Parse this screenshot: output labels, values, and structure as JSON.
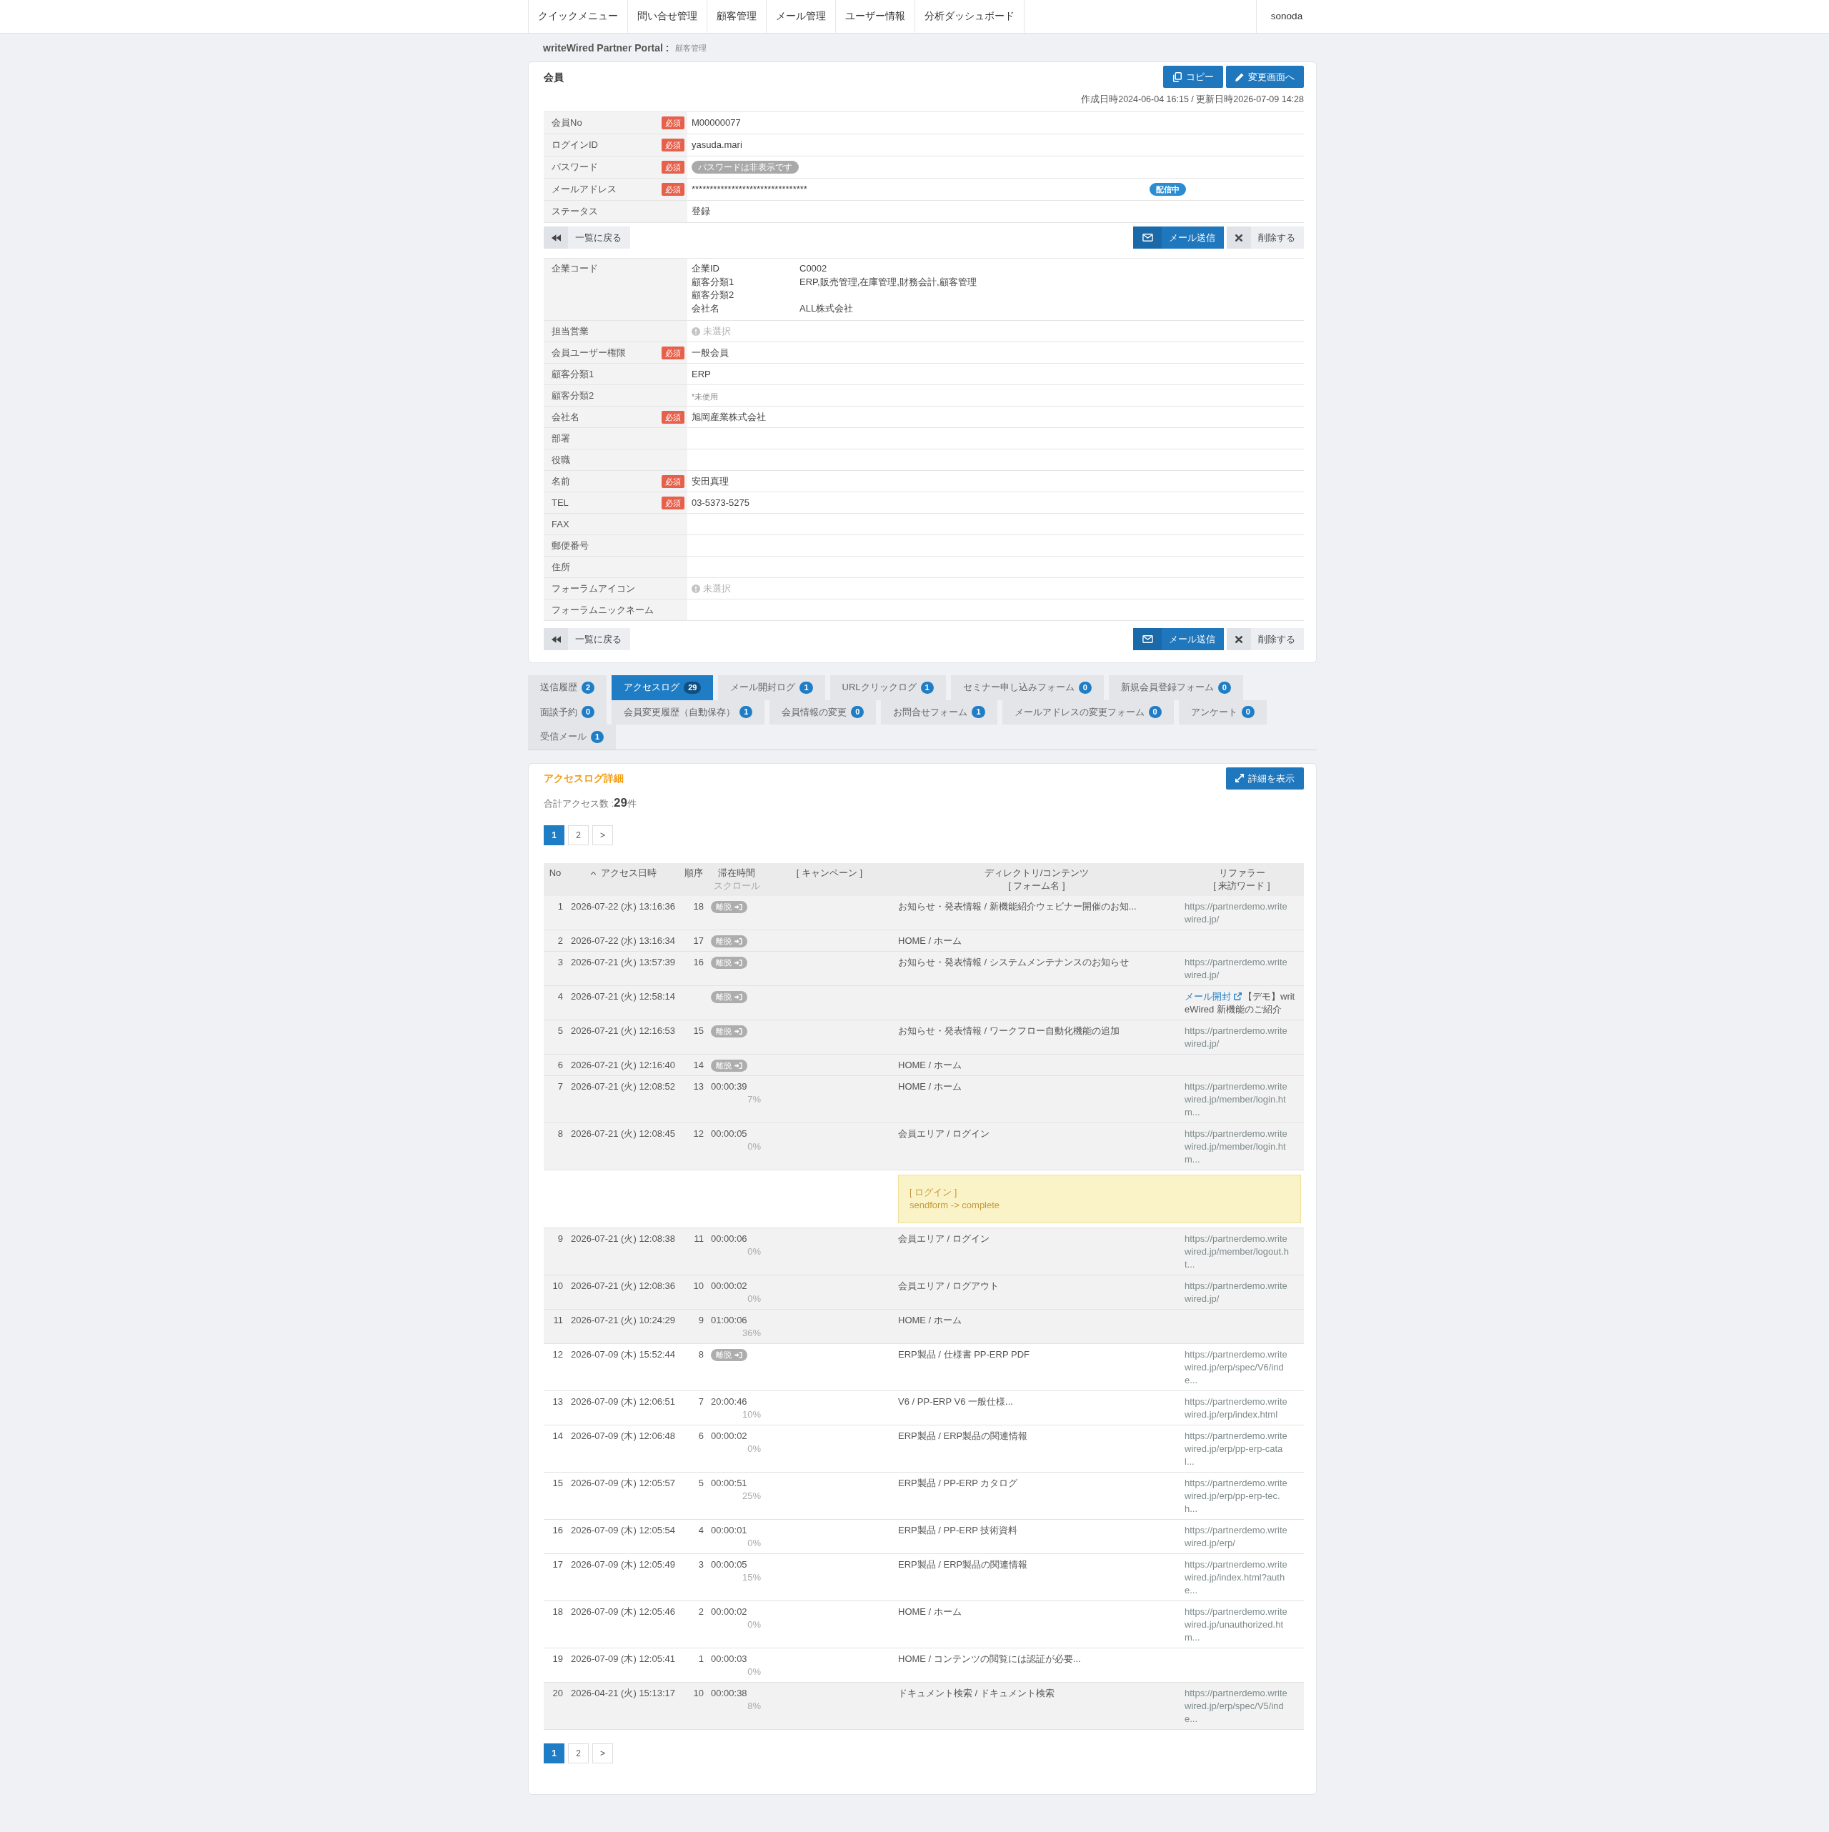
{
  "nav": {
    "items": [
      {
        "label": "クイックメニュー"
      },
      {
        "label": "問い合せ管理"
      },
      {
        "label": "顧客管理"
      },
      {
        "label": "メール管理"
      },
      {
        "label": "ユーザー情報"
      },
      {
        "label": "分析ダッシュボード"
      }
    ],
    "user": "sonoda"
  },
  "breadcrumb": {
    "portal": "writeWired Partner Portal :",
    "section": "顧客管理"
  },
  "member": {
    "title": "会員",
    "buttons": [
      {
        "kind": "copy",
        "label": "コピー"
      },
      {
        "kind": "edit",
        "label": "変更画面へ"
      }
    ],
    "timestamps": "作成日時2024-06-04 16:15 / 更新日時2026-07-09 14:28",
    "account_fields": [
      {
        "label": "会員No",
        "badge": "必須",
        "kind": "text",
        "value": "M00000077"
      },
      {
        "label": "ログインID",
        "badge": "必須",
        "kind": "text",
        "value": "yasuda.mari"
      },
      {
        "label": "パスワード",
        "badge": "必須",
        "kind": "pill",
        "value": "パスワードは非表示です"
      },
      {
        "label": "メールアドレス",
        "badge": "必須",
        "kind": "masked",
        "value": "********************************",
        "status": "配信中"
      },
      {
        "label": "ステータス",
        "kind": "text",
        "value": "登録"
      }
    ],
    "actions_top": [
      {
        "kind": "back",
        "label": "一覧に戻る"
      },
      {
        "kind": "mail",
        "label": "メール送信"
      },
      {
        "kind": "delete",
        "label": "削除する"
      }
    ],
    "profile_fields": [
      {
        "label": "企業コード",
        "kind": "company",
        "entries": [
          {
            "key": "企業ID",
            "value": "C0002"
          },
          {
            "key": "顧客分類1",
            "value": "ERP,販売管理,在庫管理,財務会計,顧客管理"
          },
          {
            "key": "顧客分類2"
          },
          {
            "key": "会社名",
            "value": "ALL株式会社"
          }
        ]
      },
      {
        "label": "担当営業",
        "kind": "unselected",
        "value": "未選択"
      },
      {
        "label": "会員ユーザー権限",
        "badge": "必須",
        "kind": "text",
        "value": "一般会員"
      },
      {
        "label": "顧客分類1",
        "kind": "text",
        "value": "ERP"
      },
      {
        "label": "顧客分類2",
        "kind": "note",
        "value": "*未使用"
      },
      {
        "label": "会社名",
        "badge": "必須",
        "kind": "text",
        "value": "旭岡産業株式会社"
      },
      {
        "label": "部署",
        "kind": "text"
      },
      {
        "label": "役職",
        "kind": "text"
      },
      {
        "label": "名前",
        "badge": "必須",
        "kind": "text",
        "value": "安田真理"
      },
      {
        "label": "TEL",
        "badge": "必須",
        "kind": "text",
        "value": "03-5373-5275"
      },
      {
        "label": "FAX",
        "kind": "text"
      },
      {
        "label": "郵便番号",
        "kind": "text"
      },
      {
        "label": "住所",
        "kind": "text"
      },
      {
        "label": "フォーラムアイコン",
        "kind": "unselected",
        "value": "未選択"
      },
      {
        "label": "フォーラムニックネーム",
        "kind": "text"
      }
    ],
    "actions_bottom": [
      {
        "kind": "back",
        "label": "一覧に戻る"
      },
      {
        "kind": "mail",
        "label": "メール送信"
      },
      {
        "kind": "delete",
        "label": "削除する"
      }
    ]
  },
  "tabs": [
    {
      "label": "送信履歴",
      "count": "2",
      "selected": false
    },
    {
      "label": "アクセスログ",
      "count": "29",
      "selected": true
    },
    {
      "label": "メール開封ログ",
      "count": "1",
      "selected": false
    },
    {
      "label": "URLクリックログ",
      "count": "1",
      "selected": false
    },
    {
      "label": "セミナー申し込みフォーム",
      "count": "0",
      "selected": false
    },
    {
      "label": "新規会員登録フォーム",
      "count": "0",
      "selected": false
    },
    {
      "label": "面談予約",
      "count": "0",
      "selected": false
    },
    {
      "label": "会員変更履歴（自動保存）",
      "count": "1",
      "selected": false
    },
    {
      "label": "会員情報の変更",
      "count": "0",
      "selected": false
    },
    {
      "label": "お問合せフォーム",
      "count": "1",
      "selected": false
    },
    {
      "label": "メールアドレスの変更フォーム",
      "count": "0",
      "selected": false
    },
    {
      "label": "アンケート",
      "count": "0",
      "selected": false
    },
    {
      "label": "受信メール",
      "count": "1",
      "selected": false
    }
  ],
  "access_log": {
    "title": "アクセスログ詳細",
    "detail_button": "詳細を表示",
    "total_label": "合計アクセス数 :",
    "total": "29",
    "total_unit": "件",
    "pagination_top": [
      {
        "label": "1",
        "selected": true
      },
      {
        "label": "2",
        "selected": false
      },
      {
        "label": ">",
        "selected": false
      }
    ],
    "columns": [
      {
        "label": "No",
        "sorted": false
      },
      {
        "label": "アクセス日時",
        "sorted": true
      },
      {
        "label": "順序",
        "sorted": false
      },
      {
        "label": "滞在時間",
        "sub": "スクロール",
        "sub_muted": true,
        "sorted": false
      },
      {
        "label": "[ キャンペーン ]",
        "sorted": false
      },
      {
        "label": "ディレクトリ/コンテンツ",
        "sub": "[ フォーム名 ]",
        "sub_muted": false,
        "sorted": false
      },
      {
        "label": "リファラー",
        "sub": "[ 来訪ワード ]",
        "sub_muted": false,
        "sorted": false
      }
    ],
    "rows": [
      {
        "no": "1",
        "datetime": "2026-07-22 (水) 13:16:36",
        "order": "18",
        "dwell": {
          "kind": "exit",
          "label": "離脱"
        },
        "content": "お知らせ・発表情報 / 新機能紹介ウェビナー開催のお知...",
        "referrer": {
          "kind": "url",
          "text": "https://partnerdemo.writewired.jp/"
        },
        "highlighted": true
      },
      {
        "no": "2",
        "datetime": "2026-07-22 (水) 13:16:34",
        "order": "17",
        "dwell": {
          "kind": "exit",
          "label": "離脱"
        },
        "content": "HOME / ホーム",
        "highlighted": true
      },
      {
        "no": "3",
        "datetime": "2026-07-21 (火) 13:57:39",
        "order": "16",
        "dwell": {
          "kind": "exit",
          "label": "離脱"
        },
        "content": "お知らせ・発表情報 / システムメンテナンスのお知らせ",
        "referrer": {
          "kind": "url",
          "text": "https://partnerdemo.writewired.jp/"
        },
        "highlighted": true
      },
      {
        "no": "4",
        "datetime": "2026-07-21 (火) 12:58:14",
        "dwell": {
          "kind": "exit",
          "label": "離脱"
        },
        "referrer": {
          "kind": "mail",
          "link": "メール開封",
          "subject": "【デモ】writeWired 新機能のご紹介"
        },
        "highlighted": true
      },
      {
        "no": "5",
        "datetime": "2026-07-21 (火) 12:16:53",
        "order": "15",
        "dwell": {
          "kind": "exit",
          "label": "離脱"
        },
        "content": "お知らせ・発表情報 / ワークフロー自動化機能の追加",
        "referrer": {
          "kind": "url",
          "text": "https://partnerdemo.writewired.jp/"
        },
        "highlighted": true
      },
      {
        "no": "6",
        "datetime": "2026-07-21 (火) 12:16:40",
        "order": "14",
        "dwell": {
          "kind": "exit",
          "label": "離脱"
        },
        "content": "HOME / ホーム",
        "highlighted": true
      },
      {
        "no": "7",
        "datetime": "2026-07-21 (火) 12:08:52",
        "order": "13",
        "dwell": {
          "kind": "time",
          "time": "00:00:39",
          "scroll": "7%"
        },
        "content": "HOME / ホーム",
        "referrer": {
          "kind": "url",
          "text": "https://partnerdemo.writewired.jp/member/login.htm..."
        },
        "highlighted": true
      },
      {
        "no": "8",
        "datetime": "2026-07-21 (火) 12:08:45",
        "order": "12",
        "dwell": {
          "kind": "time",
          "time": "00:00:05",
          "scroll": "0%"
        },
        "content": "会員エリア / ログイン",
        "referrer": {
          "kind": "url",
          "text": "https://partnerdemo.writewired.jp/member/login.htm..."
        },
        "highlighted": true,
        "form_result": {
          "name": "[ ログイン ]",
          "status": "sendform -> complete"
        }
      },
      {
        "no": "9",
        "datetime": "2026-07-21 (火) 12:08:38",
        "order": "11",
        "dwell": {
          "kind": "time",
          "time": "00:00:06",
          "scroll": "0%"
        },
        "content": "会員エリア / ログイン",
        "referrer": {
          "kind": "url",
          "text": "https://partnerdemo.writewired.jp/member/logout.ht..."
        },
        "highlighted": true
      },
      {
        "no": "10",
        "datetime": "2026-07-21 (火) 12:08:36",
        "order": "10",
        "dwell": {
          "kind": "time",
          "time": "00:00:02",
          "scroll": "0%"
        },
        "content": "会員エリア / ログアウト",
        "referrer": {
          "kind": "url",
          "text": "https://partnerdemo.writewired.jp/"
        },
        "highlighted": true
      },
      {
        "no": "11",
        "datetime": "2026-07-21 (火) 10:24:29",
        "order": "9",
        "dwell": {
          "kind": "time",
          "time": "01:00:06",
          "scroll": "36%"
        },
        "content": "HOME / ホーム",
        "highlighted": true
      },
      {
        "no": "12",
        "datetime": "2026-07-09 (木) 15:52:44",
        "order": "8",
        "dwell": {
          "kind": "exit",
          "label": "離脱"
        },
        "content": "ERP製品 / 仕様書 PP-ERP PDF",
        "referrer": {
          "kind": "url",
          "text": "https://partnerdemo.writewired.jp/erp/spec/V6/inde..."
        },
        "highlighted": false
      },
      {
        "no": "13",
        "datetime": "2026-07-09 (木) 12:06:51",
        "order": "7",
        "dwell": {
          "kind": "time",
          "time": "20:00:46",
          "scroll": "10%"
        },
        "content": "V6 / PP-ERP V6 一般仕様...",
        "referrer": {
          "kind": "url",
          "text": "https://partnerdemo.writewired.jp/erp/index.html"
        },
        "highlighted": false
      },
      {
        "no": "14",
        "datetime": "2026-07-09 (木) 12:06:48",
        "order": "6",
        "dwell": {
          "kind": "time",
          "time": "00:00:02",
          "scroll": "0%"
        },
        "content": "ERP製品 / ERP製品の関連情報",
        "referrer": {
          "kind": "url",
          "text": "https://partnerdemo.writewired.jp/erp/pp-erp-catal..."
        },
        "highlighted": false
      },
      {
        "no": "15",
        "datetime": "2026-07-09 (木) 12:05:57",
        "order": "5",
        "dwell": {
          "kind": "time",
          "time": "00:00:51",
          "scroll": "25%"
        },
        "content": "ERP製品 / PP-ERP カタログ",
        "referrer": {
          "kind": "url",
          "text": "https://partnerdemo.writewired.jp/erp/pp-erp-tec.h..."
        },
        "highlighted": false
      },
      {
        "no": "16",
        "datetime": "2026-07-09 (木) 12:05:54",
        "order": "4",
        "dwell": {
          "kind": "time",
          "time": "00:00:01",
          "scroll": "0%"
        },
        "content": "ERP製品 / PP-ERP 技術資料",
        "referrer": {
          "kind": "url",
          "text": "https://partnerdemo.writewired.jp/erp/"
        },
        "highlighted": false
      },
      {
        "no": "17",
        "datetime": "2026-07-09 (木) 12:05:49",
        "order": "3",
        "dwell": {
          "kind": "time",
          "time": "00:00:05",
          "scroll": "15%"
        },
        "content": "ERP製品 / ERP製品の関連情報",
        "referrer": {
          "kind": "url",
          "text": "https://partnerdemo.writewired.jp/index.html?authe..."
        },
        "highlighted": false
      },
      {
        "no": "18",
        "datetime": "2026-07-09 (木) 12:05:46",
        "order": "2",
        "dwell": {
          "kind": "time",
          "time": "00:00:02",
          "scroll": "0%"
        },
        "content": "HOME / ホーム",
        "referrer": {
          "kind": "url",
          "text": "https://partnerdemo.writewired.jp/unauthorized.htm..."
        },
        "highlighted": false
      },
      {
        "no": "19",
        "datetime": "2026-07-09 (木) 12:05:41",
        "order": "1",
        "dwell": {
          "kind": "time",
          "time": "00:00:03",
          "scroll": "0%"
        },
        "content": "HOME / コンテンツの閲覧には認証が必要...",
        "highlighted": false
      },
      {
        "no": "20",
        "datetime": "2026-04-21 (火) 15:13:17",
        "order": "10",
        "dwell": {
          "kind": "time",
          "time": "00:00:38",
          "scroll": "8%"
        },
        "content": "ドキュメント検索 / ドキュメント検索",
        "referrer": {
          "kind": "url",
          "text": "https://partnerdemo.writewired.jp/erp/spec/V5/inde..."
        },
        "highlighted": true
      }
    ],
    "pagination_bottom": [
      {
        "label": "1",
        "selected": true
      },
      {
        "label": "2",
        "selected": false
      },
      {
        "label": ">",
        "selected": false
      }
    ]
  }
}
